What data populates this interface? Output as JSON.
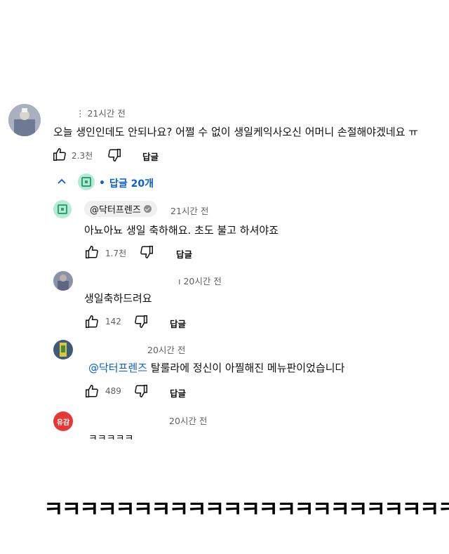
{
  "comment": {
    "meta": "21시간 전",
    "meta_prefix": "⋮",
    "text": "오늘 생인인데도 안되나요? 어쩔 수 없이 생일케익사오신 어머니 손절해야겠네요 ㅠ",
    "likes": "2.3천",
    "reply_label": "답글"
  },
  "replies_toggle": {
    "label": "답글 20개",
    "bullet": "•"
  },
  "replies": [
    {
      "handle": "@닥터프렌즈",
      "time": "21시간 전",
      "text": "아뇨아뇨 생일 축하해요. 초도 불고 하셔야죠",
      "likes": "1.7천",
      "reply_label": "답글"
    },
    {
      "time_prefix": "ı",
      "time": "20시간 전",
      "text": "생일축하드려요",
      "likes": "142",
      "reply_label": "답글"
    },
    {
      "time": "20시간 전",
      "mention": "@닥터프렌즈",
      "text": "탈룰라에 정신이 아찔해진 메뉴판이었습니다",
      "likes": "489",
      "reply_label": "답글"
    },
    {
      "avatar_text": "유감",
      "time": "20시간 전",
      "text": "ㅋㅋㅋㅋㅋ"
    }
  ],
  "caption": "ㅋㅋㅋㅋㅋㅋㅋㅋㅋㅋㅋㅋㅋㅋㅋㅋㅋㅋㅋㅋㅋㅋㅋ",
  "colors": {
    "link_blue": "#065fd4",
    "avatar_red": "#e53935",
    "logo_green": "#2aa36f"
  }
}
